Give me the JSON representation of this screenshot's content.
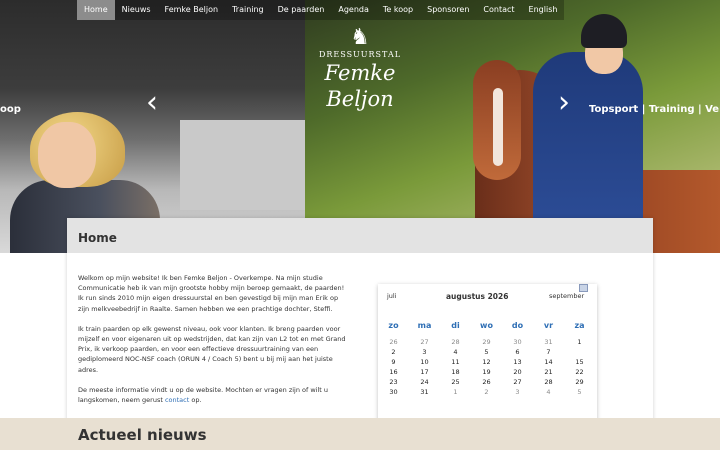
{
  "nav": [
    {
      "label": "Home",
      "active": true
    },
    {
      "label": "Nieuws"
    },
    {
      "label": "Femke Beljon"
    },
    {
      "label": "Training"
    },
    {
      "label": "De paarden"
    },
    {
      "label": "Agenda"
    },
    {
      "label": "Te koop"
    },
    {
      "label": "Sponsoren"
    },
    {
      "label": "Contact"
    },
    {
      "label": "English"
    }
  ],
  "logo": {
    "small": "DRESSUURSTAL",
    "big": "Femke Beljon"
  },
  "slider": {
    "left_text": "oop",
    "right_text": "Topsport | Training | Verko",
    "prev_icon": "chevron-left-icon",
    "next_icon": "chevron-right-icon"
  },
  "page": {
    "title": "Home",
    "intro": [
      "Welkom op mijn website! Ik ben Femke Beljon - Overkempe. Na mijn studie Communicatie heb ik van mijn grootste hobby mijn beroep gemaakt, de paarden! Ik run sinds 2010 mijn eigen dressuurstal en ben gevestigd bij mijn man Erik op zijn melkveebedrijf in Raalte. Samen hebben we een prachtige dochter, Steffi.",
      "Ik train paarden op elk gewenst niveau, ook voor klanten. Ik breng paarden voor mijzelf en voor eigenaren uit op wedstrijden, dat kan zijn van L2 tot en met Grand Prix, ik verkoop paarden, en voor een effectieve dressuurtraining van een gediplomeerd NOC-NSF coach (ORUN 4 / Coach 5) bent u bij mij aan het juiste adres."
    ],
    "last_before": "De meeste informatie vindt u op de website. Mochten er vragen zijn of wilt u langskomen, neem gerust ",
    "last_link": "contact",
    "last_after": " op."
  },
  "calendar": {
    "prev_month": "juli",
    "current_month": "augustus 2026",
    "next_month": "september",
    "day_names": [
      "zo",
      "ma",
      "di",
      "wo",
      "do",
      "vr",
      "za"
    ],
    "weeks": [
      [
        {
          "d": "26",
          "m": true
        },
        {
          "d": "27",
          "m": true
        },
        {
          "d": "28",
          "m": true
        },
        {
          "d": "29",
          "m": true
        },
        {
          "d": "30",
          "m": true
        },
        {
          "d": "31",
          "m": true
        },
        {
          "d": "1"
        }
      ],
      [
        {
          "d": "2"
        },
        {
          "d": "3"
        },
        {
          "d": "4"
        },
        {
          "d": "5"
        },
        {
          "d": "6"
        },
        {
          "d": "7"
        },
        {
          "d": ""
        }
      ],
      [
        {
          "d": "9"
        },
        {
          "d": "10"
        },
        {
          "d": "11"
        },
        {
          "d": "12"
        },
        {
          "d": "13"
        },
        {
          "d": "14"
        },
        {
          "d": "15"
        }
      ],
      [
        {
          "d": "16"
        },
        {
          "d": "17"
        },
        {
          "d": "18"
        },
        {
          "d": "19"
        },
        {
          "d": "20"
        },
        {
          "d": "21"
        },
        {
          "d": "22"
        }
      ],
      [
        {
          "d": "23"
        },
        {
          "d": "24"
        },
        {
          "d": "25"
        },
        {
          "d": "26"
        },
        {
          "d": "27"
        },
        {
          "d": "28"
        },
        {
          "d": "29"
        }
      ],
      [
        {
          "d": "30"
        },
        {
          "d": "31"
        },
        {
          "d": "1",
          "m": true
        },
        {
          "d": "2",
          "m": true
        },
        {
          "d": "3",
          "m": true
        },
        {
          "d": "4",
          "m": true
        },
        {
          "d": "5",
          "m": true
        }
      ]
    ]
  },
  "news": {
    "title": "Actueel nieuws"
  },
  "colors": {
    "accent": "#2f6fb5",
    "nav_active": "#8c8c8c",
    "band": "#e8e0d2"
  }
}
